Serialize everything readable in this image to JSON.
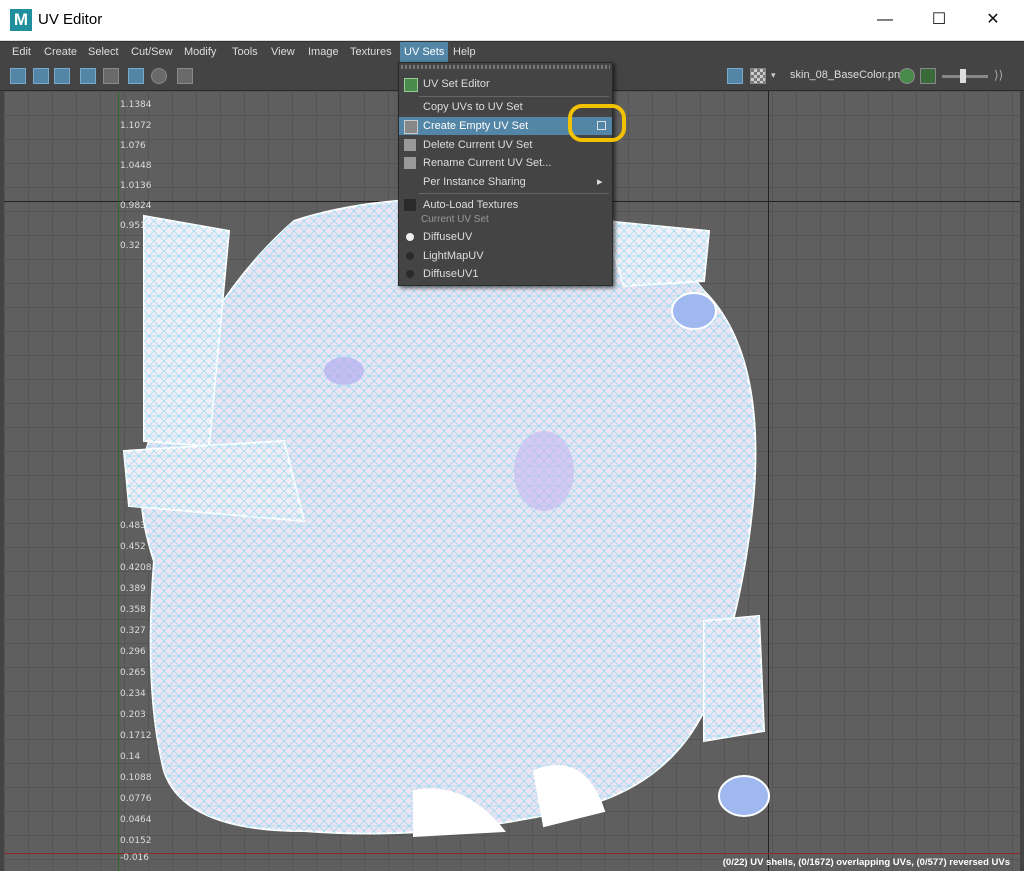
{
  "window": {
    "title": "UV Editor",
    "app_icon": "M",
    "minimize": "—",
    "maximize": "☐",
    "close": "✕"
  },
  "menubar": [
    "Edit",
    "Create",
    "Select",
    "Cut/Sew",
    "Modify",
    "Tools",
    "View",
    "Image",
    "Textures",
    "UV Sets",
    "Help"
  ],
  "toolbar": {
    "texture_name": "skin_08_BaseColor.pn"
  },
  "uv_sets_menu": {
    "items": [
      {
        "label": "UV Set Editor"
      },
      {
        "label": "Copy UVs to UV Set"
      },
      {
        "label": "Create Empty UV Set"
      },
      {
        "label": "Delete Current UV Set"
      },
      {
        "label": "Rename Current UV Set..."
      },
      {
        "label": "Per Instance Sharing",
        "submenu_arrow": "▸"
      },
      {
        "label": "Auto-Load Textures"
      }
    ],
    "section_label": "Current UV Set",
    "uv_sets": [
      {
        "label": "DiffuseUV",
        "selected": true
      },
      {
        "label": "LightMapUV",
        "selected": false
      },
      {
        "label": "DiffuseUV1",
        "selected": false
      }
    ]
  },
  "axis_ticks_v": [
    "1.1384",
    "1.1072",
    "1.076",
    "1.0448",
    "1.0136",
    "0.9824",
    "0.9512",
    "0.32",
    "0.32",
    "0.4832",
    "0.452",
    "0.4208",
    "0.389",
    "0.358",
    "0.327",
    "0.296",
    "0.265",
    "0.234",
    "0.203",
    "0.1712",
    "0.14",
    "0.1088",
    "0.0776",
    "0.0464",
    "0.0152",
    "-0.016"
  ],
  "status_text": "(0/22) UV shells, (0/1672) overlapping UVs, (0/577) reversed UVs"
}
